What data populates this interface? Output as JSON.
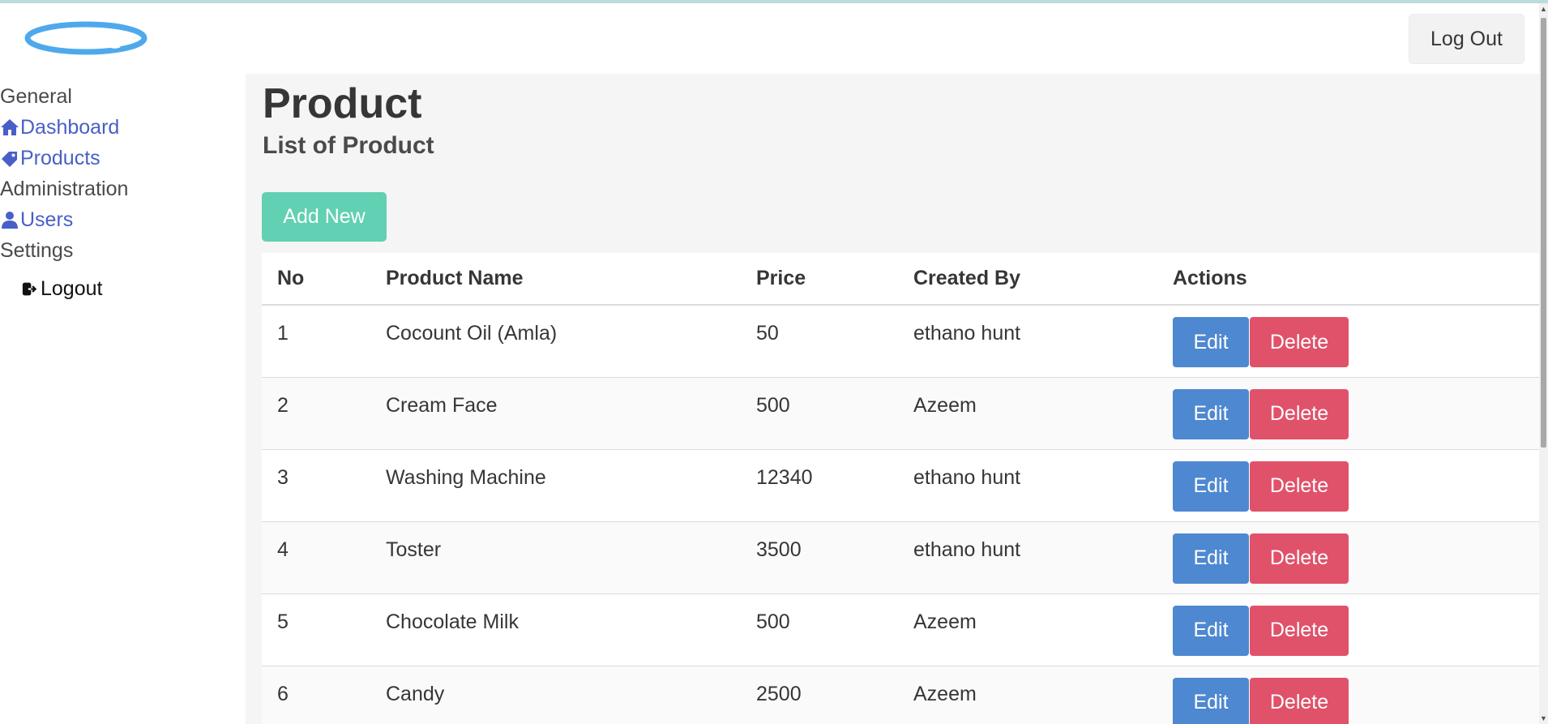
{
  "brand": {
    "logo_icon": "ellipse-logo"
  },
  "header": {
    "logout_label": "Log Out"
  },
  "sidebar": {
    "sections": [
      {
        "label": "General"
      },
      {
        "label": "Administration"
      },
      {
        "label": "Settings"
      }
    ],
    "items": [
      {
        "label": "Dashboard",
        "icon": "home-icon"
      },
      {
        "label": "Products",
        "icon": "tag-icon"
      },
      {
        "label": "Users",
        "icon": "user-icon"
      }
    ],
    "logout": {
      "label": "Logout",
      "icon": "sign-out-icon"
    }
  },
  "main": {
    "title": "Product",
    "subtitle": "List of Product",
    "add_button": "Add New",
    "table": {
      "columns": [
        "No",
        "Product Name",
        "Price",
        "Created By",
        "Actions"
      ],
      "rows": [
        {
          "no": "1",
          "name": "Cocount Oil (Amla)",
          "price": "50",
          "created_by": "ethano hunt"
        },
        {
          "no": "2",
          "name": "Cream Face",
          "price": "500",
          "created_by": "Azeem"
        },
        {
          "no": "3",
          "name": "Washing Machine",
          "price": "12340",
          "created_by": "ethano hunt"
        },
        {
          "no": "4",
          "name": "Toster",
          "price": "3500",
          "created_by": "ethano hunt"
        },
        {
          "no": "5",
          "name": "Chocolate Milk",
          "price": "500",
          "created_by": "Azeem"
        },
        {
          "no": "6",
          "name": "Candy",
          "price": "2500",
          "created_by": "Azeem"
        }
      ],
      "edit_label": "Edit",
      "delete_label": "Delete"
    }
  },
  "colors": {
    "link": "#485fc7",
    "primary": "#62d0b2",
    "info": "#4e88d0",
    "danger": "#e0526a"
  }
}
